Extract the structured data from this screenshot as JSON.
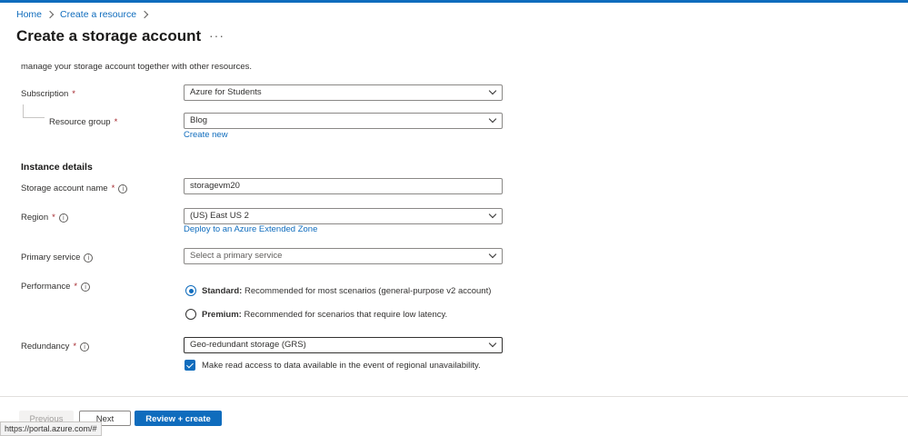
{
  "breadcrumb": {
    "home": "Home",
    "create_resource": "Create a resource"
  },
  "page": {
    "title": "Create a storage account",
    "more": "···"
  },
  "intro_text": "manage your storage account together with other resources.",
  "subscription": {
    "label": "Subscription",
    "required": "*",
    "value": "Azure for Students"
  },
  "resource_group": {
    "label": "Resource group",
    "required": "*",
    "value": "Blog",
    "create_new": "Create new"
  },
  "instance_details": {
    "title": "Instance details"
  },
  "storage_account_name": {
    "label": "Storage account name",
    "required": "*",
    "value": "storagevm20"
  },
  "region": {
    "label": "Region",
    "required": "*",
    "value": "(US) East US 2",
    "extended_zone_link": "Deploy to an Azure Extended Zone"
  },
  "primary_service": {
    "label": "Primary service",
    "placeholder": "Select a primary service"
  },
  "performance": {
    "label": "Performance",
    "required": "*",
    "options": [
      {
        "name": "Standard:",
        "desc": "Recommended for most scenarios (general-purpose v2 account)",
        "selected": true
      },
      {
        "name": "Premium:",
        "desc": "Recommended for scenarios that require low latency.",
        "selected": false
      }
    ]
  },
  "redundancy": {
    "label": "Redundancy",
    "required": "*",
    "value": "Geo-redundant storage (GRS)",
    "read_access_label": "Make read access to data available in the event of regional unavailability.",
    "read_access_checked": true
  },
  "footer": {
    "previous": "Previous",
    "next": "Next",
    "review_create": "Review + create"
  },
  "status_bar": {
    "url": "https://portal.azure.com/#"
  },
  "colors": {
    "accent": "#0f6cbd",
    "required": "#a4262c"
  },
  "icons": {
    "info": "info-icon",
    "chevron": "chevron-down-icon"
  }
}
